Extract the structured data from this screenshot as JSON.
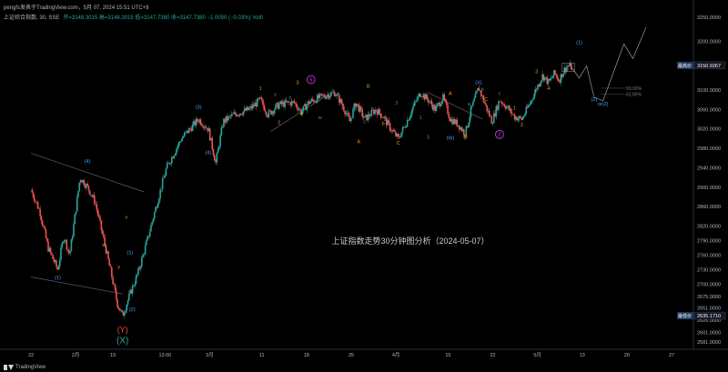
{
  "header": {
    "byline": "pengfs发表于TradingView.com，5月 07, 2024 15:51 UTC+8",
    "symbol": "上证综合指数, 30, SSE",
    "ohlc": "开=3148.3015  高=3148.3015  低=3147.7380  收=3147.7380  −1.0050 (−0.03%)",
    "volume": "Vol0"
  },
  "footer": {
    "brand": "TradingView"
  },
  "chart_data": {
    "type": "candlestick",
    "title": "上证指数走势30分钟图分析（2024-05-07）",
    "xlabel": "",
    "ylabel": "",
    "ylim": [
      2575,
      3255
    ],
    "grid": false,
    "y_ticks": [
      "3250.0000",
      "3200.0000",
      "3150.0000",
      "3100.0000",
      "3060.0000",
      "3020.0000",
      "2980.0000",
      "2940.0000",
      "2900.0000",
      "2860.0000",
      "2820.0000",
      "2790.0000",
      "2760.0000",
      "2730.0000",
      "2700.0000",
      "2675.0000",
      "2651.0000",
      "2626.0000",
      "2601.0000",
      "2581.0000"
    ],
    "y_tick_values": [
      3250,
      3200,
      3150,
      3100,
      3060,
      3020,
      2980,
      2940,
      2900,
      2860,
      2820,
      2790,
      2760,
      2730,
      2700,
      2675,
      2651,
      2626,
      2601,
      2581
    ],
    "x_ticks": [
      {
        "label": "22",
        "t": 0
      },
      {
        "label": "2月",
        "t": 6
      },
      {
        "label": "19",
        "t": 11
      },
      {
        "label": "13:00",
        "t": 18
      },
      {
        "label": "3月",
        "t": 24
      },
      {
        "label": "11",
        "t": 31
      },
      {
        "label": "18",
        "t": 37
      },
      {
        "label": "25",
        "t": 43
      },
      {
        "label": "4月",
        "t": 49
      },
      {
        "label": "15",
        "t": 56
      },
      {
        "label": "22",
        "t": 62
      },
      {
        "label": "5月",
        "t": 68
      },
      {
        "label": "13",
        "t": 74
      },
      {
        "label": "20",
        "t": 80
      },
      {
        "label": "27",
        "t": 86
      }
    ],
    "price_labels": [
      {
        "name": "最高价",
        "value": "3150.9267",
        "price": 3150.9267
      },
      {
        "name": "最低价",
        "value": "2635.1710",
        "price": 2635.171
      }
    ],
    "path": [
      [
        0,
        2895
      ],
      [
        1.2,
        2850
      ],
      [
        2.3,
        2775
      ],
      [
        3.6,
        2730
      ],
      [
        4.4,
        2800
      ],
      [
        5.2,
        2760
      ],
      [
        6.6,
        2920
      ],
      [
        7.6,
        2900
      ],
      [
        8.6,
        2870
      ],
      [
        9.8,
        2790
      ],
      [
        10.8,
        2720
      ],
      [
        11.6,
        2660
      ],
      [
        12.3,
        2635
      ],
      [
        13.3,
        2680
      ],
      [
        14.3,
        2720
      ],
      [
        15.6,
        2790
      ],
      [
        16.8,
        2860
      ],
      [
        18.2,
        2940
      ],
      [
        20.2,
        3000
      ],
      [
        22.5,
        3040
      ],
      [
        23.8,
        3020
      ],
      [
        24.8,
        2950
      ],
      [
        25.8,
        3035
      ],
      [
        27.3,
        3050
      ],
      [
        29.3,
        3060
      ],
      [
        30.8,
        3080
      ],
      [
        31.8,
        3050
      ],
      [
        33.3,
        3070
      ],
      [
        35.3,
        3075
      ],
      [
        36.3,
        3055
      ],
      [
        37.3,
        3075
      ],
      [
        38.8,
        3085
      ],
      [
        40.8,
        3095
      ],
      [
        41.8,
        3070
      ],
      [
        42.8,
        3035
      ],
      [
        43.6,
        3075
      ],
      [
        44.8,
        3040
      ],
      [
        46.3,
        3060
      ],
      [
        47.3,
        3045
      ],
      [
        48.3,
        3020
      ],
      [
        49.3,
        3000
      ],
      [
        50.3,
        3030
      ],
      [
        51.3,
        3065
      ],
      [
        52.3,
        3095
      ],
      [
        53.3,
        3080
      ],
      [
        54.3,
        3060
      ],
      [
        55.3,
        3085
      ],
      [
        56.3,
        3040
      ],
      [
        57.3,
        3030
      ],
      [
        58.3,
        3010
      ],
      [
        59.1,
        3060
      ],
      [
        60.1,
        3105
      ],
      [
        61.1,
        3065
      ],
      [
        61.9,
        3035
      ],
      [
        62.9,
        3080
      ],
      [
        63.9,
        3065
      ],
      [
        64.9,
        3045
      ],
      [
        65.9,
        3040
      ],
      [
        66.9,
        3070
      ],
      [
        67.9,
        3105
      ],
      [
        68.7,
        3130
      ],
      [
        69.5,
        3115
      ],
      [
        70.3,
        3135
      ],
      [
        70.9,
        3120
      ],
      [
        71.5,
        3140
      ],
      [
        72.1,
        3150.9
      ],
      [
        72.6,
        3146
      ]
    ],
    "projection": [
      [
        72.6,
        3146
      ],
      [
        73.6,
        3125
      ],
      [
        74.6,
        3150
      ],
      [
        75.6,
        3085
      ],
      [
        76.8,
        3078
      ],
      [
        79.6,
        3195
      ],
      [
        80.8,
        3165
      ],
      [
        82.6,
        3230
      ]
    ],
    "trend_lines": [
      {
        "from": [
          0,
          2970
        ],
        "to": [
          15.2,
          2890
        ]
      },
      {
        "from": [
          0,
          2715
        ],
        "to": [
          12.3,
          2680
        ]
      },
      {
        "from": [
          32.2,
          3015
        ],
        "to": [
          40.3,
          3095
        ]
      },
      {
        "from": [
          53.3,
          3095
        ],
        "to": [
          60.6,
          3040
        ]
      }
    ],
    "fib_levels": [
      {
        "label": "50.00%",
        "price": 3104
      },
      {
        "label": "61.80%",
        "price": 3092
      }
    ],
    "wave_labels": [
      {
        "text": "(4)",
        "t": 7.6,
        "price": 2950,
        "color": "#42a5f5"
      },
      {
        "text": "(1)",
        "t": 3.6,
        "price": 2710,
        "color": "#42a5f5"
      },
      {
        "text": "(1)",
        "t": 13.3,
        "price": 2762,
        "color": "#42a5f5"
      },
      {
        "text": "(2)",
        "t": 13.6,
        "price": 2645,
        "color": "#42a5f5"
      },
      {
        "text": "x",
        "t": 12.8,
        "price": 2835,
        "color": "#ff9800"
      },
      {
        "text": "w",
        "t": 9.8,
        "price": 2778,
        "color": "#ff9800"
      },
      {
        "text": "y",
        "t": 11.8,
        "price": 2733,
        "color": "#ff9800"
      },
      {
        "text": "(Y)",
        "t": 12.3,
        "price": 2601,
        "color": "#f44336",
        "size": 9
      },
      {
        "text": "(X)",
        "t": 12.3,
        "price": 2578,
        "color": "#26a69a",
        "size": 10
      },
      {
        "text": "(3)",
        "t": 22.5,
        "price": 3062,
        "color": "#42a5f5"
      },
      {
        "text": "(4)",
        "t": 23.8,
        "price": 2968,
        "color": "#42a5f5"
      },
      {
        "text": "1",
        "t": 30.8,
        "price": 3100,
        "color": "#ff9800"
      },
      {
        "text": "2",
        "t": 33.3,
        "price": 3030,
        "color": "#ff9800"
      },
      {
        "text": "3",
        "t": 35.8,
        "price": 3112,
        "color": "#ff9800"
      },
      {
        "text": "4",
        "t": 36.3,
        "price": 3048,
        "color": "#ff9800"
      },
      {
        "text": "5",
        "t": 37.6,
        "price": 3118,
        "color": "#e040fb",
        "circled": true
      },
      {
        "text": "w",
        "t": 31.8,
        "price": 3044,
        "color": "#26a69a"
      },
      {
        "text": "x",
        "t": 32.8,
        "price": 3088,
        "color": "#26a69a"
      },
      {
        "text": "y",
        "t": 34.8,
        "price": 3082,
        "color": "#26a69a"
      },
      {
        "text": "w",
        "t": 38.8,
        "price": 3040,
        "color": "#26a69a"
      },
      {
        "text": "x",
        "t": 40.3,
        "price": 3090,
        "color": "#26a69a"
      },
      {
        "text": "a",
        "t": 41.8,
        "price": 3060,
        "color": "#26a69a"
      },
      {
        "text": "b",
        "t": 43.6,
        "price": 3058,
        "color": "#26a69a"
      },
      {
        "text": "c",
        "t": 44.8,
        "price": 3032,
        "color": "#26a69a"
      },
      {
        "text": "A",
        "t": 44.0,
        "price": 2990,
        "color": "#ff9800"
      },
      {
        "text": "B",
        "t": 45.3,
        "price": 3105,
        "color": "#ff9800"
      },
      {
        "text": "b",
        "t": 47.3,
        "price": 3028,
        "color": "#ff9800"
      },
      {
        "text": "C",
        "t": 49.3,
        "price": 2988,
        "color": "#ff9800"
      },
      {
        "text": "2",
        "t": 49.1,
        "price": 3070,
        "color": "#26a69a"
      },
      {
        "text": "1",
        "t": 52.3,
        "price": 3040,
        "color": "#26a69a"
      },
      {
        "text": "3",
        "t": 53.3,
        "price": 3000,
        "color": "#26a69a"
      },
      {
        "text": "(W)",
        "t": 56.3,
        "price": 2998,
        "color": "#42a5f5"
      },
      {
        "text": "(X)",
        "t": 60.1,
        "price": 3112,
        "color": "#42a5f5"
      },
      {
        "text": "A",
        "t": 56.3,
        "price": 3090,
        "color": "#ff9800"
      },
      {
        "text": "B",
        "t": 58.3,
        "price": 3000,
        "color": "#ff9800"
      },
      {
        "text": "C",
        "t": 61.1,
        "price": 3078,
        "color": "#ff9800"
      },
      {
        "text": "a",
        "t": 58.8,
        "price": 3068,
        "color": "#26a69a"
      },
      {
        "text": "b",
        "t": 60.6,
        "price": 3098,
        "color": "#26a69a"
      },
      {
        "text": "c",
        "t": 62.9,
        "price": 3090,
        "color": "#26a69a"
      },
      {
        "text": "2",
        "t": 62.9,
        "price": 3005,
        "color": "#e040fb",
        "circled": true
      },
      {
        "text": "1",
        "t": 64.9,
        "price": 3060,
        "color": "#ff9800"
      },
      {
        "text": "2",
        "t": 65.9,
        "price": 3025,
        "color": "#ff9800"
      },
      {
        "text": "3",
        "t": 67.9,
        "price": 3135,
        "color": "#ff9800"
      },
      {
        "text": "4",
        "t": 69.5,
        "price": 3100,
        "color": "#ff9800"
      },
      {
        "text": "(1)",
        "t": 73.6,
        "price": 3195,
        "color": "#42a5f5"
      },
      {
        "text": "(2)",
        "t": 75.6,
        "price": 3078,
        "color": "#42a5f5"
      },
      {
        "text": "or(2)",
        "t": 76.8,
        "price": 3068,
        "color": "#42a5f5"
      }
    ]
  }
}
